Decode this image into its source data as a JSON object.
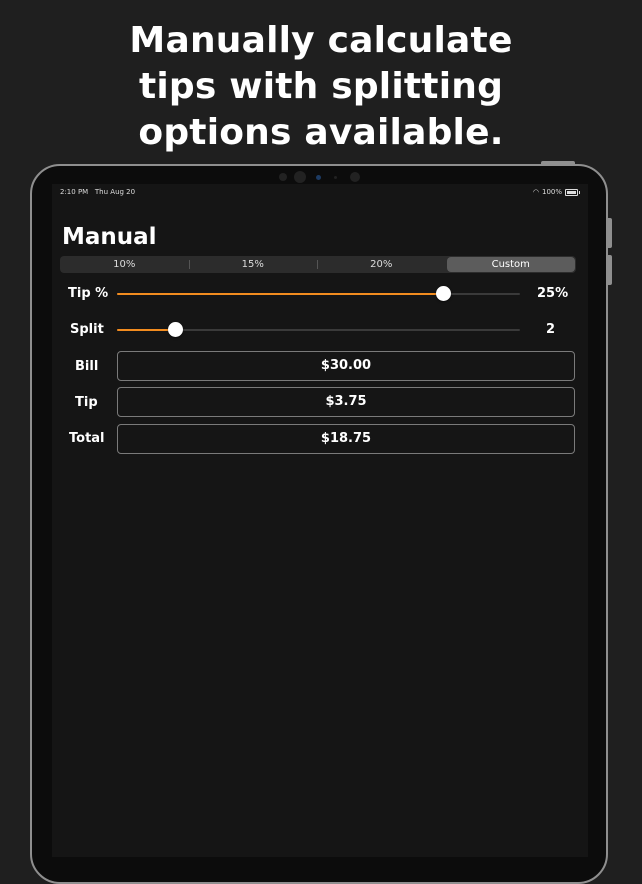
{
  "headline": {
    "line1": "Manually calculate",
    "line2": "tips with splitting",
    "line3": "options available."
  },
  "status_bar": {
    "time": "2:10 PM",
    "date": "Thu Aug 20",
    "battery": "100%",
    "icons": [
      "wifi-icon",
      "battery-icon"
    ]
  },
  "page_title": "Manual",
  "tip_presets": {
    "options": [
      "10%",
      "15%",
      "20%",
      "Custom"
    ],
    "selected": "Custom"
  },
  "tip_slider": {
    "label": "Tip %",
    "value_text": "25%",
    "level": 0.81
  },
  "split_slider": {
    "label": "Split",
    "value_text": "2",
    "level": 0.145
  },
  "bill": {
    "label": "Bill",
    "value": "$30.00"
  },
  "tip": {
    "label": "Tip",
    "value": "$3.75"
  },
  "total": {
    "label": "Total",
    "value": "$18.75"
  },
  "colors": {
    "accent": "#f28c1f",
    "background": "#151515",
    "page": "#1f1f1f"
  }
}
